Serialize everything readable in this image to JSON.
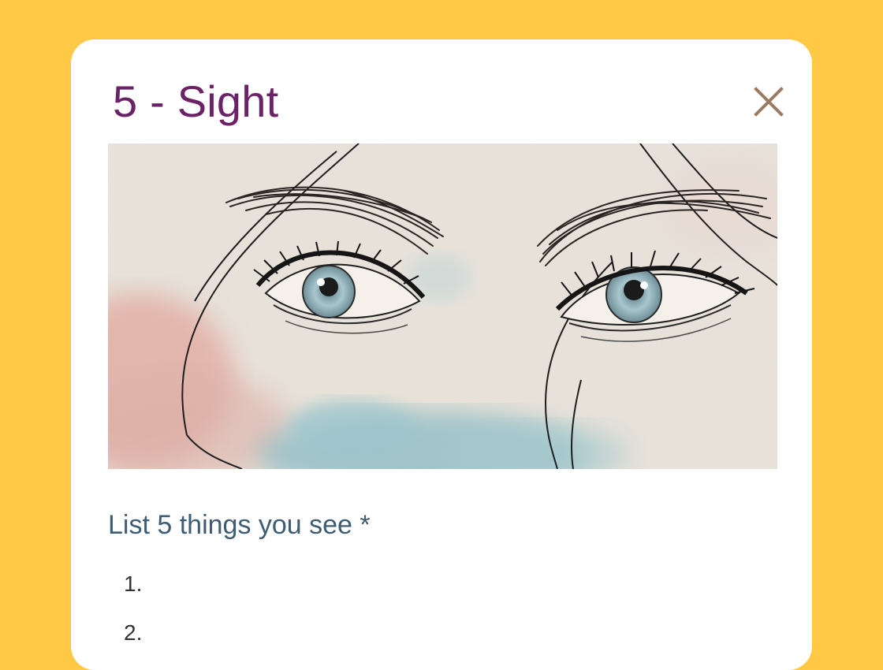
{
  "dialog": {
    "title": "5 - Sight",
    "close_icon": "close-icon",
    "image_subject": "watercolor-eyes-illustration",
    "prompt": "List 5 things you see *",
    "items": [
      {
        "number": "1.",
        "value": ""
      },
      {
        "number": "2.",
        "value": ""
      }
    ]
  },
  "colors": {
    "background": "#FFC845",
    "card": "#FFFFFF",
    "title": "#6B2266",
    "close": "#9C7B63",
    "prompt": "#3E5C72"
  }
}
